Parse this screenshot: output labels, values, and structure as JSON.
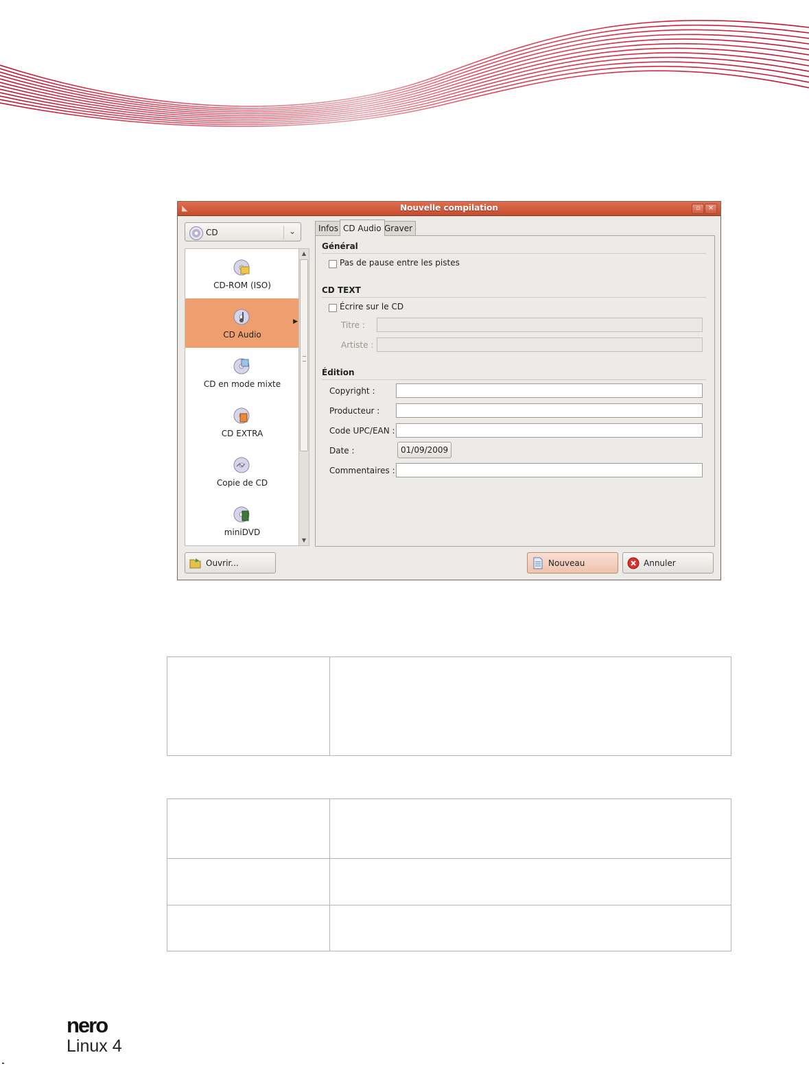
{
  "dialog": {
    "title": "Nouvelle compilation",
    "combo_value": "CD",
    "list_items": [
      {
        "label": "CD-ROM (ISO)",
        "icon": "cd-rom-iso-icon"
      },
      {
        "label": "CD Audio",
        "icon": "cd-audio-icon",
        "selected": true
      },
      {
        "label": "CD en mode mixte",
        "icon": "cd-mixed-mode-icon"
      },
      {
        "label": "CD EXTRA",
        "icon": "cd-extra-icon"
      },
      {
        "label": "Copie de CD",
        "icon": "cd-copy-icon"
      },
      {
        "label": "miniDVD",
        "icon": "minidvd-icon"
      }
    ],
    "tabs": [
      "Infos",
      "CD Audio",
      "Graver"
    ],
    "active_tab": "CD Audio",
    "general": {
      "heading": "Général",
      "no_pause": "Pas de pause entre les pistes"
    },
    "cd_text": {
      "heading": "CD TEXT",
      "write": "Écrire sur le CD",
      "title_label": "Titre :",
      "artist_label": "Artiste :"
    },
    "edition": {
      "heading": "Édition",
      "copyright_label": "Copyright :",
      "producer_label": "Producteur :",
      "upc_label": "Code UPC/EAN :",
      "date_label": "Date :",
      "date_value": "01/09/2009",
      "comments_label": "Commentaires :"
    },
    "buttons": {
      "open": "Ouvrir...",
      "new": "Nouveau",
      "cancel": "Annuler"
    }
  },
  "footer": {
    "brand": "nero",
    "product": "Linux 4"
  },
  "colors": {
    "accent": "#c8102e",
    "titlebar": "#d45a3c",
    "selected_item": "#ef9f6d"
  }
}
